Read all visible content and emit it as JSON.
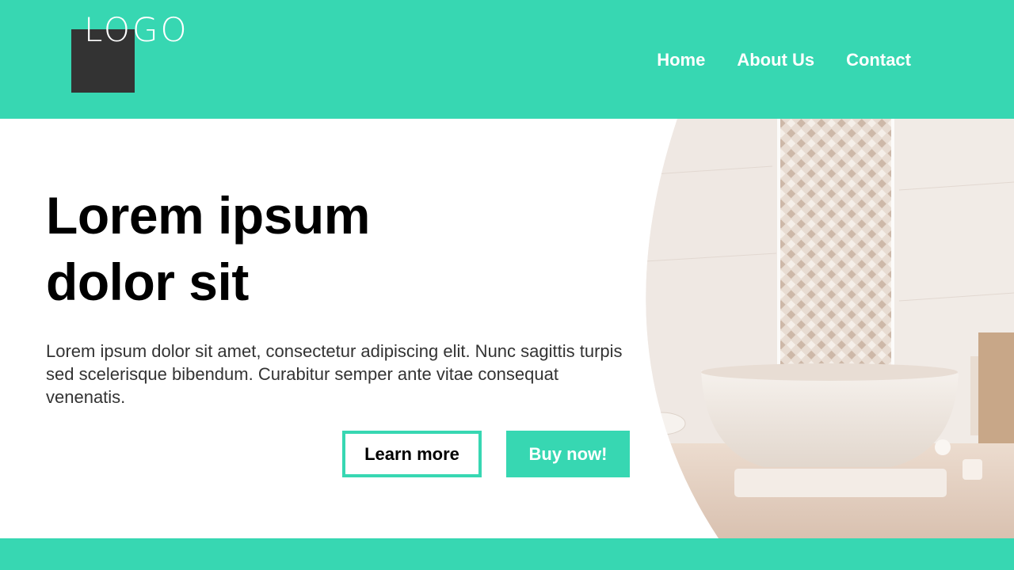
{
  "colors": {
    "accent": "#37d7b2",
    "logo_box": "#333333",
    "text_dark": "#000000",
    "text_body": "#333333"
  },
  "header": {
    "logo_text": "LOGO",
    "nav": [
      {
        "label": "Home"
      },
      {
        "label": "About Us"
      },
      {
        "label": "Contact"
      }
    ]
  },
  "hero": {
    "headline_line1": "Lorem ipsum",
    "headline_line2": "dolor sit",
    "body": "Lorem ipsum dolor sit amet, consectetur adipiscing elit. Nunc sagittis turpis sed scelerisque bibendum. Curabitur semper ante vitae consequat venenatis.",
    "learn_more_label": "Learn more",
    "buy_now_label": "Buy now!",
    "image": "bathroom-photo"
  }
}
